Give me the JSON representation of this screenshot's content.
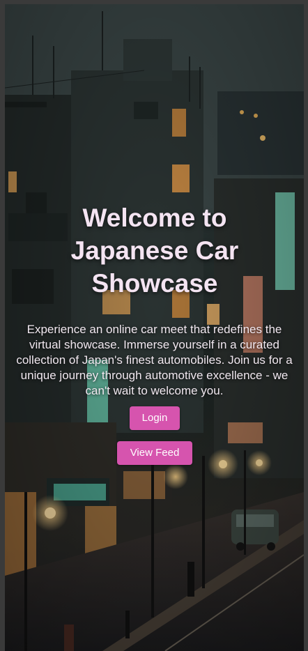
{
  "hero": {
    "title": "Welcome to Japanese Car Showcase",
    "description": "Experience an online car meet that redefines the virtual showcase. Immerse yourself in a curated collection of Japan's finest automobiles. Join us for a unique journey through automotive excellence - we can't wait to welcome you.",
    "background_image": "night-street-illustration"
  },
  "actions": {
    "login_label": "Login",
    "feed_label": "View Feed"
  },
  "colors": {
    "button": "#d654ae",
    "title_text": "#f4e4f2",
    "body_text": "#f1e8f0"
  }
}
